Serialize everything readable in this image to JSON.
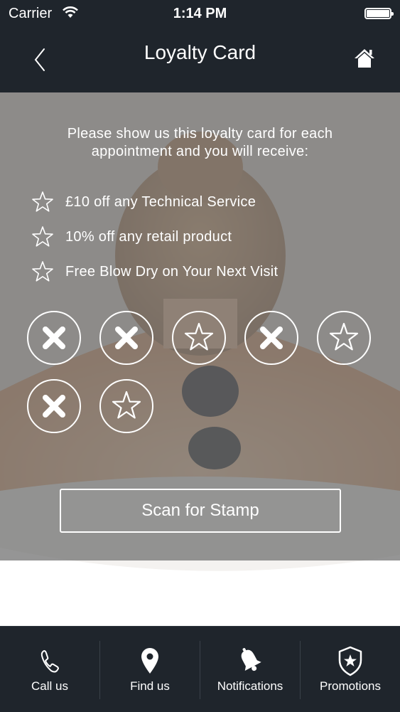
{
  "status_bar": {
    "carrier": "Carrier",
    "time": "1:14 PM",
    "wifi_icon": "wifi-icon",
    "battery_icon": "battery-icon"
  },
  "nav": {
    "title": "Loyalty Card",
    "back_icon": "chevron-left-icon",
    "home_icon": "home-icon"
  },
  "card": {
    "intro": "Please show us this loyalty card for each appointment and you will receive:",
    "benefits": [
      "£10 off any Technical Service",
      "10% off any retail product",
      "Free Blow Dry on Your Next Visit"
    ],
    "stamps": [
      {
        "state": "stamped",
        "icon": "cross-icon"
      },
      {
        "state": "stamped",
        "icon": "cross-icon"
      },
      {
        "state": "empty",
        "icon": "star-icon"
      },
      {
        "state": "stamped",
        "icon": "cross-icon"
      },
      {
        "state": "empty",
        "icon": "star-icon"
      },
      {
        "state": "stamped",
        "icon": "cross-icon"
      },
      {
        "state": "empty",
        "icon": "star-icon"
      }
    ],
    "scan_button": "Scan for Stamp"
  },
  "tabs": [
    {
      "label": "Call us",
      "icon": "phone-icon"
    },
    {
      "label": "Find us",
      "icon": "map-pin-icon"
    },
    {
      "label": "Notifications",
      "icon": "bell-icon"
    },
    {
      "label": "Promotions",
      "icon": "shield-star-icon"
    }
  ],
  "colors": {
    "bar_background": "#1f252c",
    "overlay": "#6c6c6c",
    "text": "#ffffff"
  }
}
